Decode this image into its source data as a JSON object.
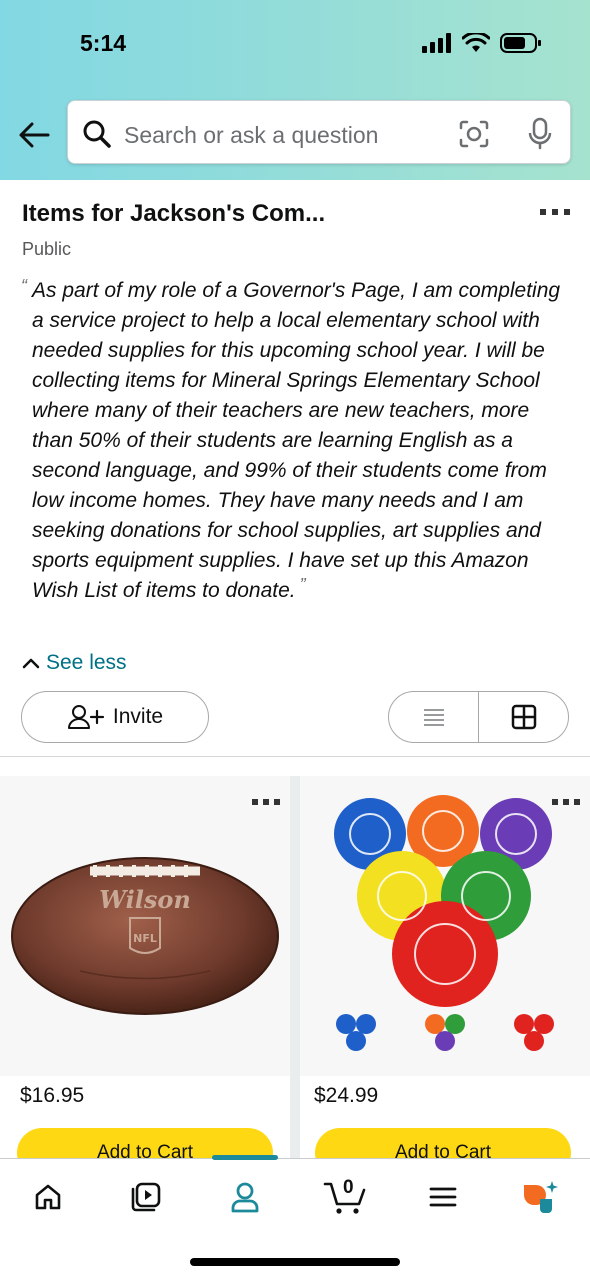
{
  "status_bar": {
    "time": "5:14"
  },
  "search": {
    "placeholder": "Search or ask a question"
  },
  "list": {
    "title": "Items for Jackson's Com...",
    "visibility": "Public",
    "description": "As part of my role of a Governor's Page, I am completing a service project to help a local elementary school with needed supplies for this upcoming school year. I will be collecting items for Mineral Springs Elementary School where many of their teachers are new teachers, more than 50% of their students are learning English as a second language, and 99% of their students come from low income homes. They have many needs and I am seeking donations for school supplies, art supplies and sports equipment supplies. I have set up this Amazon Wish List of items to donate.",
    "quote_open": "“",
    "quote_close": "”",
    "see_less": "See less",
    "invite_label": "Invite"
  },
  "products": [
    {
      "price": "$16.95",
      "add_to_cart": "Add to Cart",
      "image": "wilson-nfl-football"
    },
    {
      "price": "$24.99",
      "add_to_cart": "Add to Cart",
      "image": "playground-dodgeballs"
    }
  ],
  "bottom_nav": {
    "items": [
      "home-icon",
      "video-icon",
      "account-icon",
      "cart-icon",
      "menu-icon",
      "rufus-icon"
    ],
    "cart_count": "0",
    "active": "account-icon"
  },
  "colors": {
    "accent_teal": "#007185",
    "cart_yellow": "#ffd814",
    "nav_active": "#1c8a9b"
  }
}
